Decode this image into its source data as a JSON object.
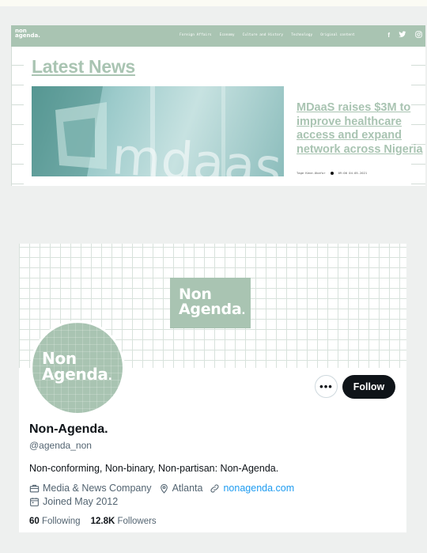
{
  "website": {
    "logo_line1": "non",
    "logo_line2": "agenda.",
    "nav": [
      "Foreign Affairs",
      "Economy",
      "Culture and History",
      "Technology",
      "Original content"
    ],
    "social_icons": [
      "facebook-icon",
      "twitter-icon",
      "instagram-icon"
    ],
    "section_title": "Latest News",
    "article": {
      "title": "MDaaS raises $3M to improve healthcare access and expand network across Nigeria",
      "author": "Tage Kene-Okafor",
      "timestamp": "09:00 04.05.2021"
    },
    "image_text": "mdaas"
  },
  "profile": {
    "banner_logo_line1": "Non",
    "banner_logo_line2": "Agenda",
    "avatar_logo_line1": "Non",
    "avatar_logo_line2": "Agenda",
    "logo_dot": ".",
    "more_label": "•••",
    "follow_label": "Follow",
    "name": "Non-Agenda.",
    "handle": "@agenda_non",
    "bio": "Non-conforming, Non-binary, Non-partisan: Non-Agenda.",
    "category": "Media & News Company",
    "location": "Atlanta",
    "website": "nonagenda.com",
    "joined": "Joined May 2012",
    "following_count": "60",
    "following_label": "Following",
    "followers_count": "12.8K",
    "followers_label": "Followers"
  },
  "colors": {
    "brand_green": "#a9c4b2",
    "link_blue": "#1d9bf0",
    "button_black": "#0f1419"
  }
}
